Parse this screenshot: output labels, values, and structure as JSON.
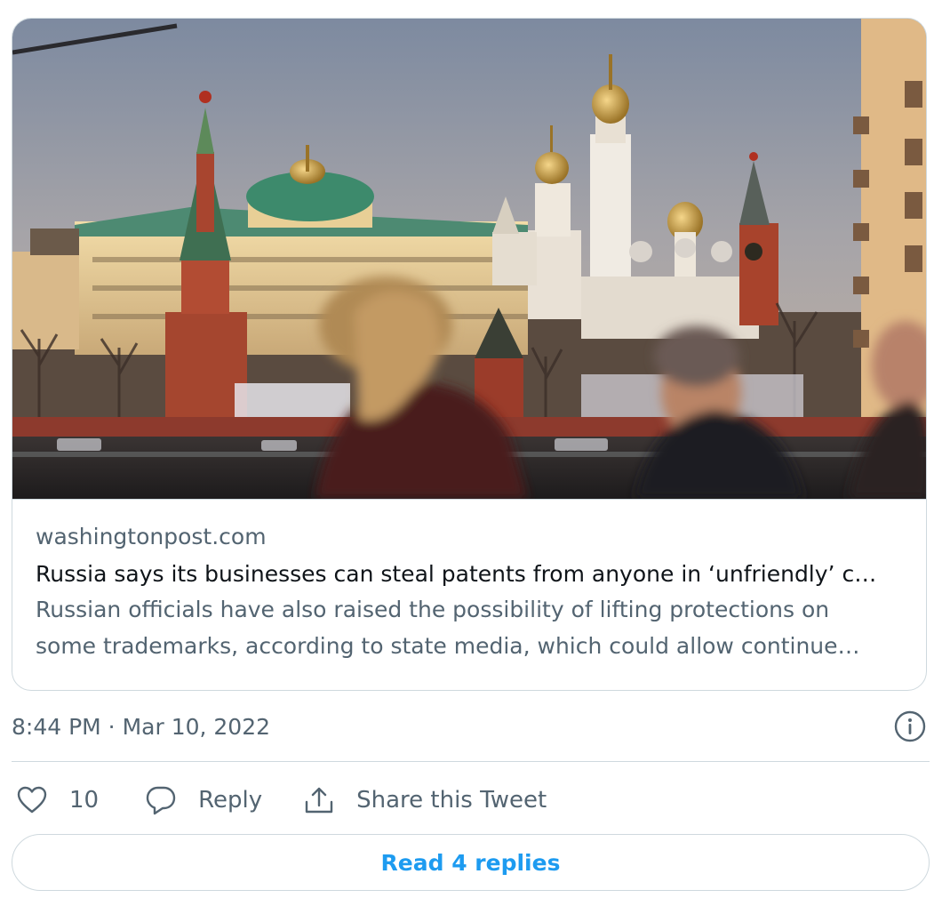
{
  "card": {
    "image_alt": "Kremlin skyline at sunset with passersby",
    "domain": "washingtonpost.com",
    "headline": "Russia says its businesses can steal patents from anyone in ‘unfriendly’ c…",
    "description_line1": "Russian officials have also raised the possibility of lifting protections on",
    "description_line2": "some trademarks, according to state media, which could allow continue…"
  },
  "tweet": {
    "timestamp": "8:44 PM · Mar 10, 2022",
    "info_icon": "info-icon"
  },
  "actions": {
    "like_icon": "heart-icon",
    "like_count": "10",
    "reply_icon": "speech-bubble-icon",
    "reply_label": "Reply",
    "share_icon": "share-upload-icon",
    "share_label": "Share this Tweet"
  },
  "footer": {
    "read_replies_label": "Read 4 replies"
  },
  "colors": {
    "link_blue": "#1d9bf0",
    "secondary_text": "#536471",
    "border": "#cfd9de"
  }
}
